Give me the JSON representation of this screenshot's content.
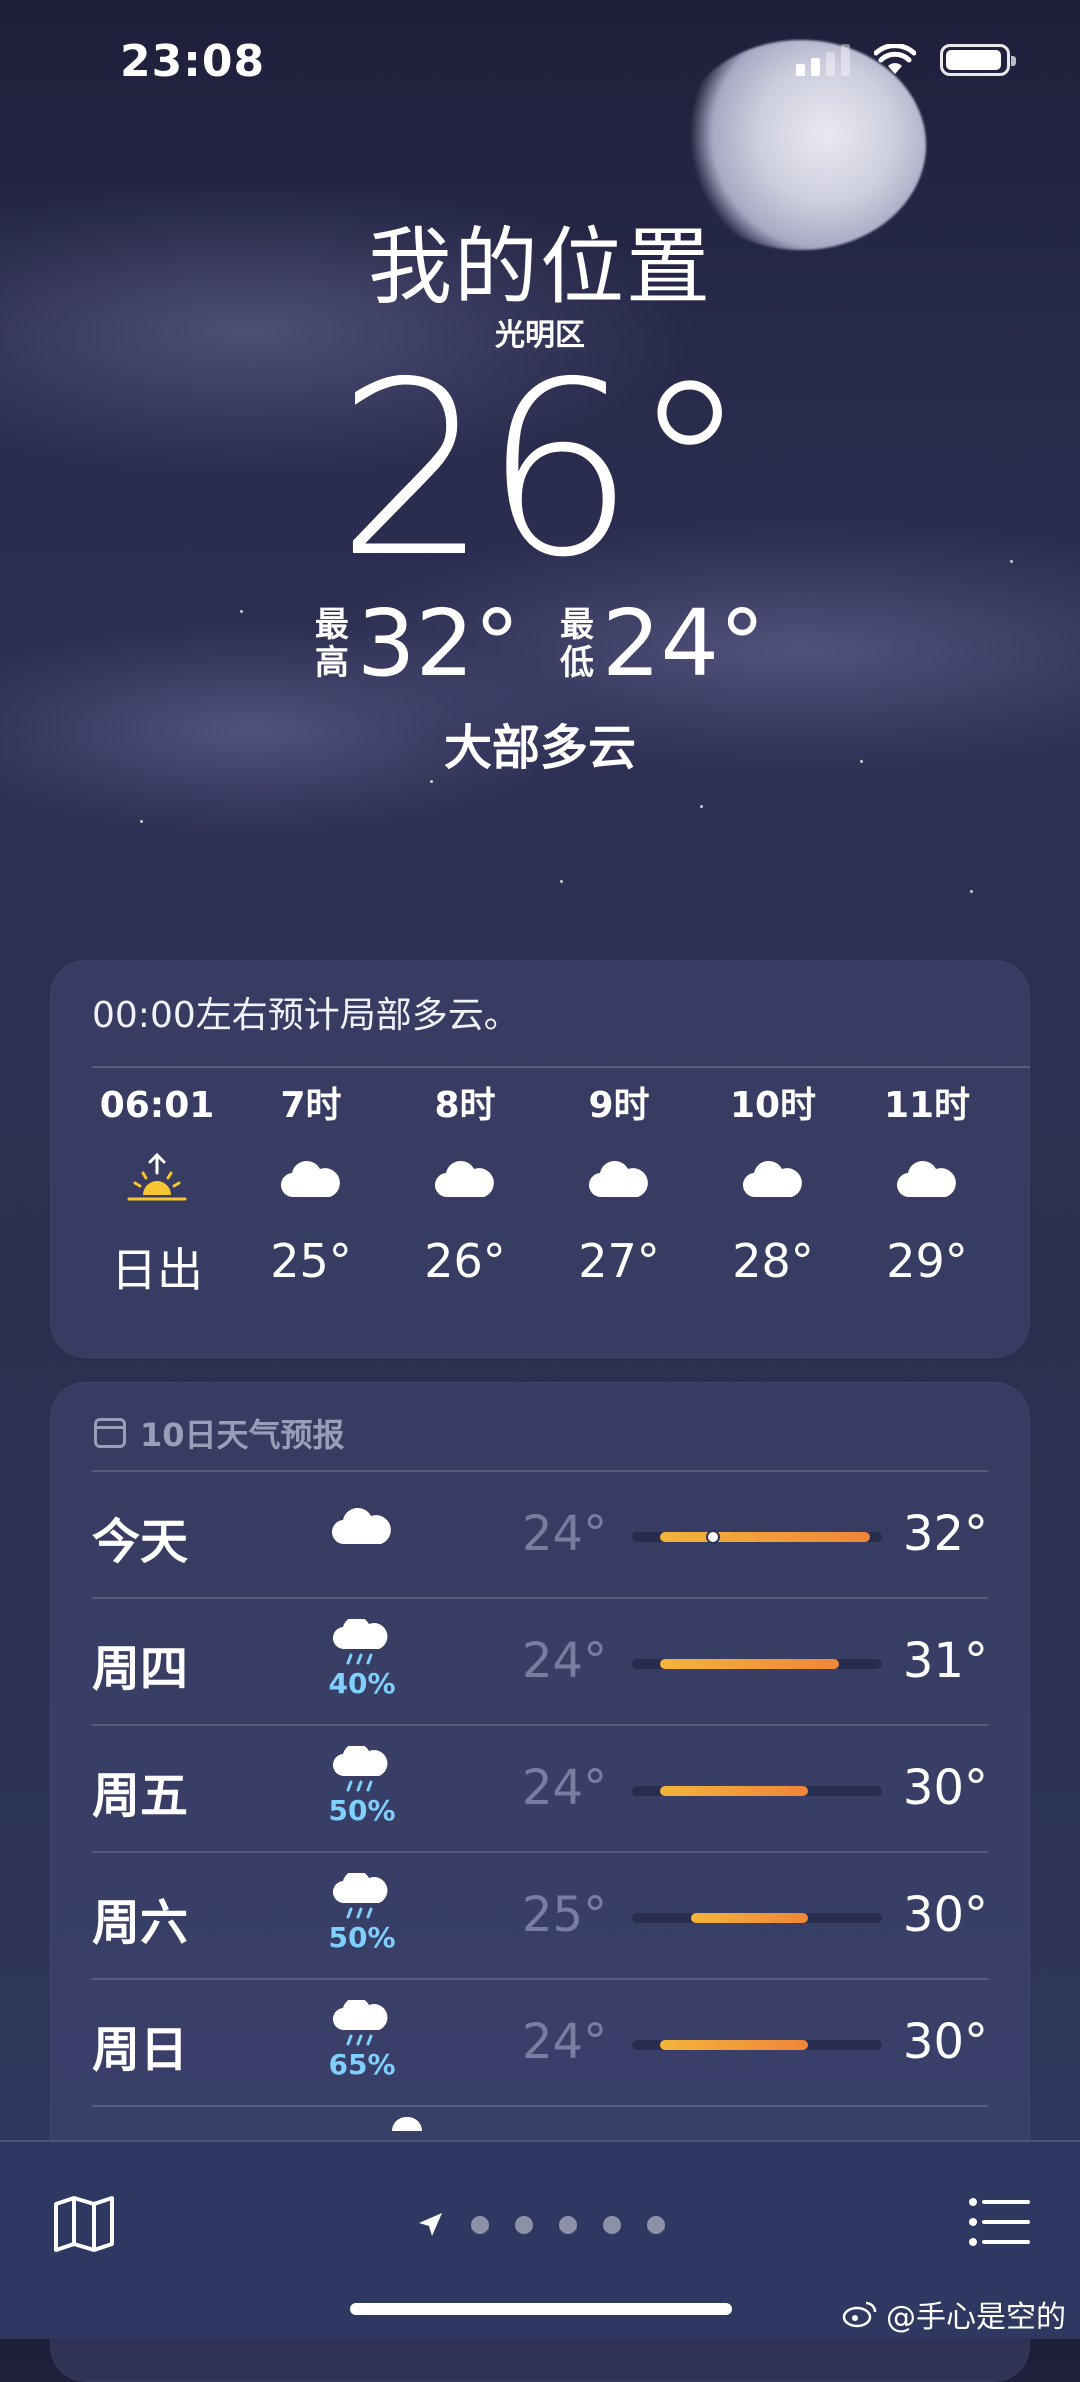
{
  "status_bar": {
    "time": "23:08",
    "battery_level": 0.95
  },
  "header": {
    "title": "我的位置",
    "subtitle": "光明区",
    "temperature": "26°",
    "high_tag_1": "最",
    "high_tag_2": "高",
    "high": "32°",
    "low_tag_1": "最",
    "low_tag_2": "低",
    "low": "24°",
    "condition": "大部多云"
  },
  "hourly": {
    "summary": "00:00左右预计局部多云。",
    "items": [
      {
        "label": "06:01",
        "icon": "sunrise-icon",
        "temp": "日出"
      },
      {
        "label": "7时",
        "icon": "cloud-icon",
        "temp": "25°"
      },
      {
        "label": "8时",
        "icon": "cloud-icon",
        "temp": "26°"
      },
      {
        "label": "9时",
        "icon": "cloud-icon",
        "temp": "27°"
      },
      {
        "label": "10时",
        "icon": "cloud-icon",
        "temp": "28°"
      },
      {
        "label": "11时",
        "icon": "cloud-icon",
        "temp": "29°"
      }
    ]
  },
  "daily": {
    "header": "10日天气预报",
    "range_min": 24,
    "range_max": 32,
    "days": [
      {
        "name": "今天",
        "icon": "cloud-icon",
        "prob": "",
        "low": "24°",
        "high": "32°",
        "low_val": 24,
        "high_val": 32,
        "now_val": 26
      },
      {
        "name": "周四",
        "icon": "rain-cloud-icon",
        "prob": "40%",
        "low": "24°",
        "high": "31°",
        "low_val": 24,
        "high_val": 31
      },
      {
        "name": "周五",
        "icon": "rain-cloud-icon",
        "prob": "50%",
        "low": "24°",
        "high": "30°",
        "low_val": 24,
        "high_val": 30
      },
      {
        "name": "周六",
        "icon": "rain-cloud-icon",
        "prob": "50%",
        "low": "25°",
        "high": "30°",
        "low_val": 25,
        "high_val": 30
      },
      {
        "name": "周日",
        "icon": "rain-cloud-icon",
        "prob": "65%",
        "low": "24°",
        "high": "30°",
        "low_val": 24,
        "high_val": 30
      }
    ]
  },
  "bottom_bar": {
    "page_count": 5
  },
  "watermark": "@手心是空的",
  "colors": {
    "bar_start": "#f2b53a",
    "bar_end": "#f0853a",
    "precip": "#7fd0ff",
    "sun": "#f7c531"
  }
}
